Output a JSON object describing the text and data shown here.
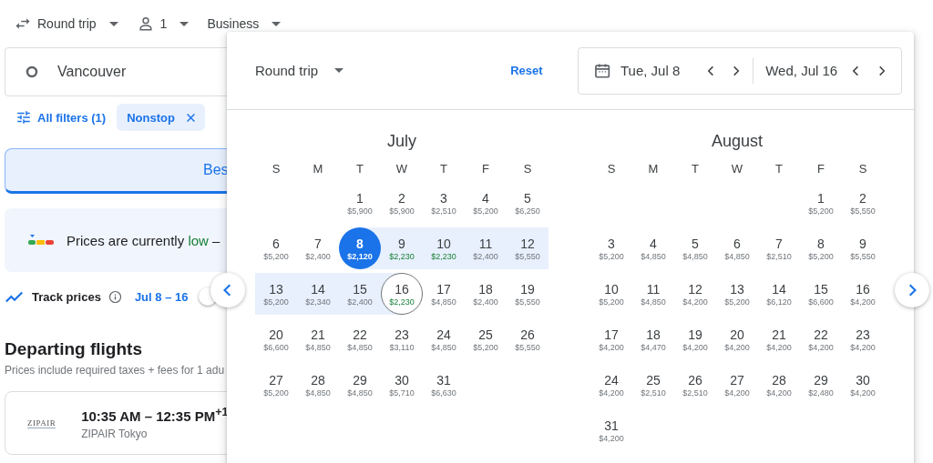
{
  "top_bar": {
    "trip_type": "Round trip",
    "passengers": "1",
    "cabin": "Business"
  },
  "origin": {
    "value": "Vancouver"
  },
  "filters": {
    "all_filters": "All filters (1)",
    "chips": [
      {
        "label": "Nonstop"
      }
    ]
  },
  "sort_tab": {
    "label": "Bes",
    "selected": true
  },
  "price_insight": {
    "prefix": "Prices are currently",
    "status": "low",
    "suffix": "–"
  },
  "track": {
    "label": "Track prices",
    "dates": "Jul 8 – 16",
    "on": false
  },
  "departing": {
    "title": "Departing flights",
    "note": "Prices include required taxes + fees for 1 adu",
    "flights": [
      {
        "airline_logo": "ZIPAIR",
        "times": "10:35 AM – 12:35 PM$^{+1}$",
        "airline": "ZIPAIR Tokyo"
      }
    ]
  },
  "date_picker": {
    "trip_type": "Round trip",
    "reset": "Reset",
    "departure": "Tue, Jul 8",
    "return": "Wed, Jul 16",
    "months": [
      {
        "name": "July",
        "weekdays": [
          "S",
          "M",
          "T",
          "W",
          "T",
          "F",
          "S"
        ],
        "weeks": [
          {
            "align_right": true,
            "days": [
              {
                "day": "1",
                "price": "$5,900",
                "low": false,
                "departure": false,
                "return": false,
                "in_range": false
              },
              {
                "day": "2",
                "price": "$5,900",
                "low": false,
                "departure": false,
                "return": false,
                "in_range": false
              },
              {
                "day": "3",
                "price": "$2,510",
                "low": false,
                "departure": false,
                "return": false,
                "in_range": false
              },
              {
                "day": "4",
                "price": "$5,200",
                "low": false,
                "departure": false,
                "return": false,
                "in_range": false
              },
              {
                "day": "5",
                "price": "$6,250",
                "low": false,
                "departure": false,
                "return": false,
                "in_range": false
              }
            ]
          },
          {
            "days": [
              {
                "day": "6",
                "price": "$5,200",
                "low": false,
                "departure": false,
                "return": false,
                "in_range": false
              },
              {
                "day": "7",
                "price": "$2,400",
                "low": false,
                "departure": false,
                "return": false,
                "in_range": false
              },
              {
                "day": "8",
                "price": "$2,120",
                "low": false,
                "departure": true,
                "return": false,
                "in_range": false
              },
              {
                "day": "9",
                "price": "$2,230",
                "low": true,
                "departure": false,
                "return": false,
                "in_range": true
              },
              {
                "day": "10",
                "price": "$2,230",
                "low": true,
                "departure": false,
                "return": false,
                "in_range": true
              },
              {
                "day": "11",
                "price": "$2,400",
                "low": false,
                "departure": false,
                "return": false,
                "in_range": true
              },
              {
                "day": "12",
                "price": "$5,550",
                "low": false,
                "departure": false,
                "return": false,
                "in_range": true
              }
            ]
          },
          {
            "days": [
              {
                "day": "13",
                "price": "$5,200",
                "low": false,
                "departure": false,
                "return": false,
                "in_range": true
              },
              {
                "day": "14",
                "price": "$2,340",
                "low": false,
                "departure": false,
                "return": false,
                "in_range": true
              },
              {
                "day": "15",
                "price": "$2,400",
                "low": false,
                "departure": false,
                "return": false,
                "in_range": true
              },
              {
                "day": "16",
                "price": "$2,230",
                "low": true,
                "departure": false,
                "return": true,
                "in_range": false
              },
              {
                "day": "17",
                "price": "$4,850",
                "low": false,
                "departure": false,
                "return": false,
                "in_range": false
              },
              {
                "day": "18",
                "price": "$2,400",
                "low": false,
                "departure": false,
                "return": false,
                "in_range": false
              },
              {
                "day": "19",
                "price": "$5,550",
                "low": false,
                "departure": false,
                "return": false,
                "in_range": false
              }
            ]
          },
          {
            "days": [
              {
                "day": "20",
                "price": "$6,600",
                "low": false,
                "departure": false,
                "return": false,
                "in_range": false
              },
              {
                "day": "21",
                "price": "$4,850",
                "low": false,
                "departure": false,
                "return": false,
                "in_range": false
              },
              {
                "day": "22",
                "price": "$4,850",
                "low": false,
                "departure": false,
                "return": false,
                "in_range": false
              },
              {
                "day": "23",
                "price": "$3,110",
                "low": false,
                "departure": false,
                "return": false,
                "in_range": false
              },
              {
                "day": "24",
                "price": "$4,850",
                "low": false,
                "departure": false,
                "return": false,
                "in_range": false
              },
              {
                "day": "25",
                "price": "$5,200",
                "low": false,
                "departure": false,
                "return": false,
                "in_range": false
              },
              {
                "day": "26",
                "price": "$5,550",
                "low": false,
                "departure": false,
                "return": false,
                "in_range": false
              }
            ]
          },
          {
            "align_right": false,
            "days": [
              {
                "day": "27",
                "price": "$5,200",
                "low": false,
                "departure": false,
                "return": false,
                "in_range": false
              },
              {
                "day": "28",
                "price": "$4,850",
                "low": false,
                "departure": false,
                "return": false,
                "in_range": false
              },
              {
                "day": "29",
                "price": "$4,850",
                "low": false,
                "departure": false,
                "return": false,
                "in_range": false
              },
              {
                "day": "30",
                "price": "$5,710",
                "low": false,
                "departure": false,
                "return": false,
                "in_range": false
              },
              {
                "day": "31",
                "price": "$6,630",
                "low": false,
                "departure": false,
                "return": false,
                "in_range": false
              }
            ]
          }
        ]
      },
      {
        "name": "August",
        "weekdays": [
          "S",
          "M",
          "T",
          "W",
          "T",
          "F",
          "S"
        ],
        "weeks": [
          {
            "align_right": true,
            "days": [
              {
                "day": "1",
                "price": "$5,200",
                "low": false,
                "departure": false,
                "return": false,
                "in_range": false
              },
              {
                "day": "2",
                "price": "$5,550",
                "low": false,
                "departure": false,
                "return": false,
                "in_range": false
              }
            ]
          },
          {
            "days": [
              {
                "day": "3",
                "price": "$5,200",
                "low": false,
                "departure": false,
                "return": false,
                "in_range": false
              },
              {
                "day": "4",
                "price": "$4,850",
                "low": false,
                "departure": false,
                "return": false,
                "in_range": false
              },
              {
                "day": "5",
                "price": "$4,850",
                "low": false,
                "departure": false,
                "return": false,
                "in_range": false
              },
              {
                "day": "6",
                "price": "$4,850",
                "low": false,
                "departure": false,
                "return": false,
                "in_range": false
              },
              {
                "day": "7",
                "price": "$2,510",
                "low": false,
                "departure": false,
                "return": false,
                "in_range": false
              },
              {
                "day": "8",
                "price": "$5,200",
                "low": false,
                "departure": false,
                "return": false,
                "in_range": false
              },
              {
                "day": "9",
                "price": "$5,550",
                "low": false,
                "departure": false,
                "return": false,
                "in_range": false
              }
            ]
          },
          {
            "days": [
              {
                "day": "10",
                "price": "$5,200",
                "low": false,
                "departure": false,
                "return": false,
                "in_range": false
              },
              {
                "day": "11",
                "price": "$4,850",
                "low": false,
                "departure": false,
                "return": false,
                "in_range": false
              },
              {
                "day": "12",
                "price": "$4,200",
                "low": false,
                "departure": false,
                "return": false,
                "in_range": false
              },
              {
                "day": "13",
                "price": "$5,200",
                "low": false,
                "departure": false,
                "return": false,
                "in_range": false
              },
              {
                "day": "14",
                "price": "$6,120",
                "low": false,
                "departure": false,
                "return": false,
                "in_range": false
              },
              {
                "day": "15",
                "price": "$6,600",
                "low": false,
                "departure": false,
                "return": false,
                "in_range": false
              },
              {
                "day": "16",
                "price": "$4,200",
                "low": false,
                "departure": false,
                "return": false,
                "in_range": false
              }
            ]
          },
          {
            "days": [
              {
                "day": "17",
                "price": "$4,200",
                "low": false,
                "departure": false,
                "return": false,
                "in_range": false
              },
              {
                "day": "18",
                "price": "$4,470",
                "low": false,
                "departure": false,
                "return": false,
                "in_range": false
              },
              {
                "day": "19",
                "price": "$4,200",
                "low": false,
                "departure": false,
                "return": false,
                "in_range": false
              },
              {
                "day": "20",
                "price": "$4,200",
                "low": false,
                "departure": false,
                "return": false,
                "in_range": false
              },
              {
                "day": "21",
                "price": "$4,200",
                "low": false,
                "departure": false,
                "return": false,
                "in_range": false
              },
              {
                "day": "22",
                "price": "$4,200",
                "low": false,
                "departure": false,
                "return": false,
                "in_range": false
              },
              {
                "day": "23",
                "price": "$4,200",
                "low": false,
                "departure": false,
                "return": false,
                "in_range": false
              }
            ]
          },
          {
            "days": [
              {
                "day": "24",
                "price": "$4,200",
                "low": false,
                "departure": false,
                "return": false,
                "in_range": false
              },
              {
                "day": "25",
                "price": "$2,510",
                "low": false,
                "departure": false,
                "return": false,
                "in_range": false
              },
              {
                "day": "26",
                "price": "$2,510",
                "low": false,
                "departure": false,
                "return": false,
                "in_range": false
              },
              {
                "day": "27",
                "price": "$4,200",
                "low": false,
                "departure": false,
                "return": false,
                "in_range": false
              },
              {
                "day": "28",
                "price": "$4,200",
                "low": false,
                "departure": false,
                "return": false,
                "in_range": false
              },
              {
                "day": "29",
                "price": "$2,480",
                "low": false,
                "departure": false,
                "return": false,
                "in_range": false
              },
              {
                "day": "30",
                "price": "$4,200",
                "low": false,
                "departure": false,
                "return": false,
                "in_range": false
              }
            ]
          },
          {
            "align_right": false,
            "days": [
              {
                "day": "31",
                "price": "$4,200",
                "low": false,
                "departure": false,
                "return": false,
                "in_range": false
              }
            ]
          }
        ]
      }
    ]
  }
}
